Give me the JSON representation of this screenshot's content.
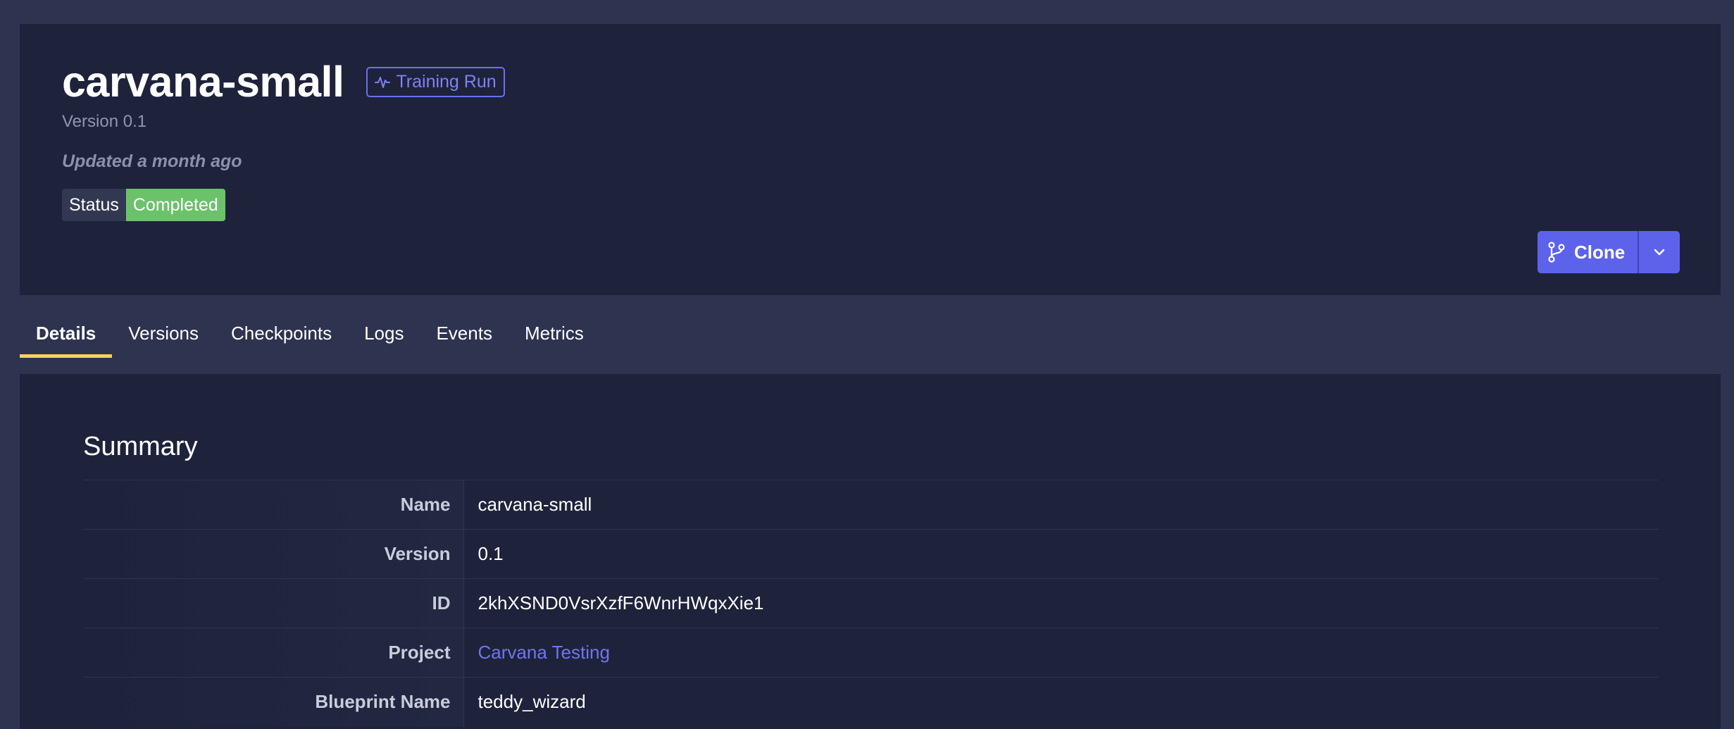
{
  "header": {
    "title": "carvana-small",
    "type_badge": "Training Run",
    "version_text": "Version 0.1",
    "updated_text": "Updated a month ago",
    "status_label": "Status",
    "status_value": "Completed",
    "clone_label": "Clone"
  },
  "tabs": [
    {
      "label": "Details",
      "active": true
    },
    {
      "label": "Versions"
    },
    {
      "label": "Checkpoints"
    },
    {
      "label": "Logs"
    },
    {
      "label": "Events"
    },
    {
      "label": "Metrics"
    }
  ],
  "summary": {
    "title": "Summary",
    "rows": [
      {
        "key": "Name",
        "value": "carvana-small"
      },
      {
        "key": "Version",
        "value": "0.1"
      },
      {
        "key": "ID",
        "value": "2khXSND0VsrXzfF6WnrHWqxXie1"
      },
      {
        "key": "Project",
        "value": "Carvana Testing"
      },
      {
        "key": "Blueprint Name",
        "value": "teddy_wizard"
      }
    ]
  },
  "colors": {
    "background": "#2e3350",
    "panel": "#1e223b",
    "accent": "#5c63ea",
    "status_completed": "#6bc26b",
    "active_tab_underline": "#f4d35e",
    "link": "#6f76ee"
  },
  "icons": {
    "type_badge": "activity-pulse-icon",
    "clone": "git-branch-icon",
    "clone_menu": "chevron-down-icon"
  }
}
